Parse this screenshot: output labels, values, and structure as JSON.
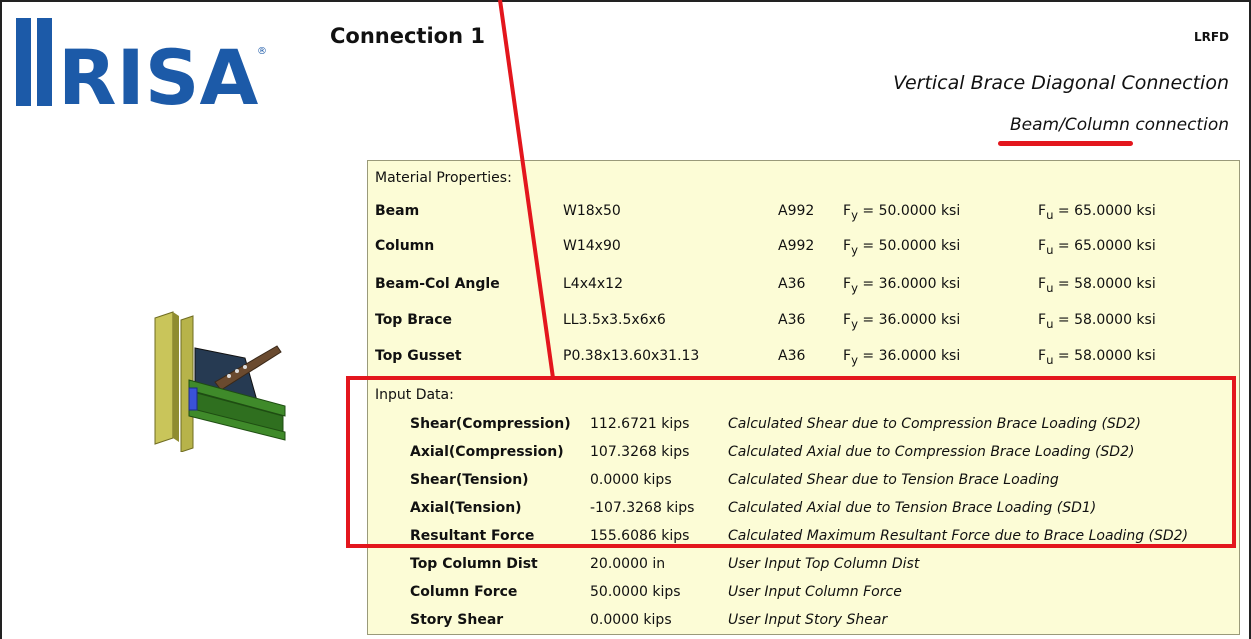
{
  "logo": {
    "text": "RISA",
    "registered": "®",
    "color": "#1c5aa8"
  },
  "header": {
    "title": "Connection 1",
    "code": "LRFD",
    "connection_type": "Vertical Brace Diagonal Connection",
    "connection_subtype": "Beam/Column connection"
  },
  "material": {
    "label": "Material Properties:",
    "rows": [
      {
        "name": "Beam",
        "shape": "W18x50",
        "grade": "A992",
        "fy_label": "F",
        "fy_sub": "y",
        "fy_value": "= 50.0000 ksi",
        "fu_label": "F",
        "fu_sub": "u",
        "fu_value": "= 65.0000 ksi"
      },
      {
        "name": "Column",
        "shape": "W14x90",
        "grade": "A992",
        "fy_label": "F",
        "fy_sub": "y",
        "fy_value": "= 50.0000 ksi",
        "fu_label": "F",
        "fu_sub": "u",
        "fu_value": "= 65.0000 ksi"
      },
      {
        "name": "Beam-Col Angle",
        "shape": "L4x4x12",
        "grade": "A36",
        "fy_label": "F",
        "fy_sub": "y",
        "fy_value": "= 36.0000 ksi",
        "fu_label": "F",
        "fu_sub": "u",
        "fu_value": "= 58.0000 ksi"
      },
      {
        "name": "Top Brace",
        "shape": "LL3.5x3.5x6x6",
        "grade": "A36",
        "fy_label": "F",
        "fy_sub": "y",
        "fy_value": "= 36.0000 ksi",
        "fu_label": "F",
        "fu_sub": "u",
        "fu_value": "= 58.0000 ksi"
      },
      {
        "name": "Top Gusset",
        "shape": "P0.38x13.60x31.13",
        "grade": "A36",
        "fy_label": "F",
        "fy_sub": "y",
        "fy_value": "= 36.0000 ksi",
        "fu_label": "F",
        "fu_sub": "u",
        "fu_value": "= 58.0000 ksi"
      }
    ]
  },
  "input": {
    "label": "Input Data:",
    "rows": [
      {
        "name": "Shear(Compression)",
        "value": "112.6721 kips",
        "desc": "Calculated Shear due to Compression Brace Loading (SD2)"
      },
      {
        "name": "Axial(Compression)",
        "value": "107.3268 kips",
        "desc": "Calculated Axial due to Compression Brace Loading (SD2)"
      },
      {
        "name": "Shear(Tension)",
        "value": "0.0000 kips",
        "desc": "Calculated Shear due to Tension Brace Loading"
      },
      {
        "name": "Axial(Tension)",
        "value": "-107.3268 kips",
        "desc": "Calculated Axial due to Tension Brace Loading (SD1)"
      },
      {
        "name": "Resultant Force",
        "value": "155.6086 kips",
        "desc": "Calculated Maximum Resultant Force due to Brace Loading (SD2)"
      },
      {
        "name": "Top Column Dist",
        "value": "20.0000 in",
        "desc": "User Input Top Column Dist"
      },
      {
        "name": "Column Force",
        "value": "50.0000 kips",
        "desc": "User Input Column Force"
      },
      {
        "name": "Story Shear",
        "value": "0.0000 kips",
        "desc": "User Input Story Shear"
      }
    ]
  },
  "annotation_color": "#e3161d",
  "panel_color": "#fcfcd6"
}
